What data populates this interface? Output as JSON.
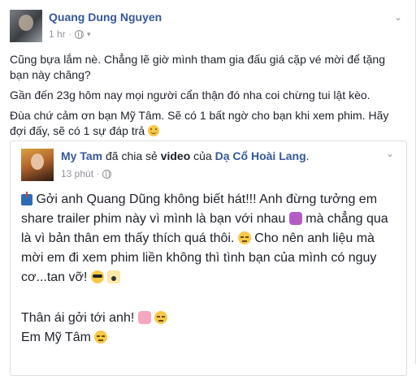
{
  "post": {
    "author": "Quang Dung Nguyen",
    "time": "1 hr",
    "lines": [
      "Cũng bựa lắm nè. Chẳng lẽ giờ mình tham gia đấu giá cặp vé mời để tặng bạn này chăng?",
      "Gần đến 23g hôm nay mọi người cẩn thận đó nha coi chừng tui lật kèo.",
      "Đùa chứ cảm ơn bạn Mỹ Tâm. Sẽ có 1 bất ngờ cho bạn khi xem phim. Hãy đợi đấy, sẽ có 1 sự đáp trả"
    ]
  },
  "shared": {
    "author": "My Tam",
    "action_pre": "đã chia sẻ",
    "object": "video",
    "of_word": "của",
    "page": "Dạ Cổ Hoài Lang",
    "time": "13 phút",
    "p1_a": "Gởi anh Quang Dũng không biết hát!!! Anh đừng tưởng em share trailer phim này vì mình là bạn với nhau",
    "p1_b": "mà chẳng qua là vì bản thân em thấy thích quá thôi.",
    "p1_c": "Cho nên anh liệu mà mời em đi xem phim liền không thì tình bạn của mình có nguy cơ...tan vỡ!",
    "p2": "Thân ái gởi tới anh!",
    "p3": "Em Mỹ Tâm"
  }
}
